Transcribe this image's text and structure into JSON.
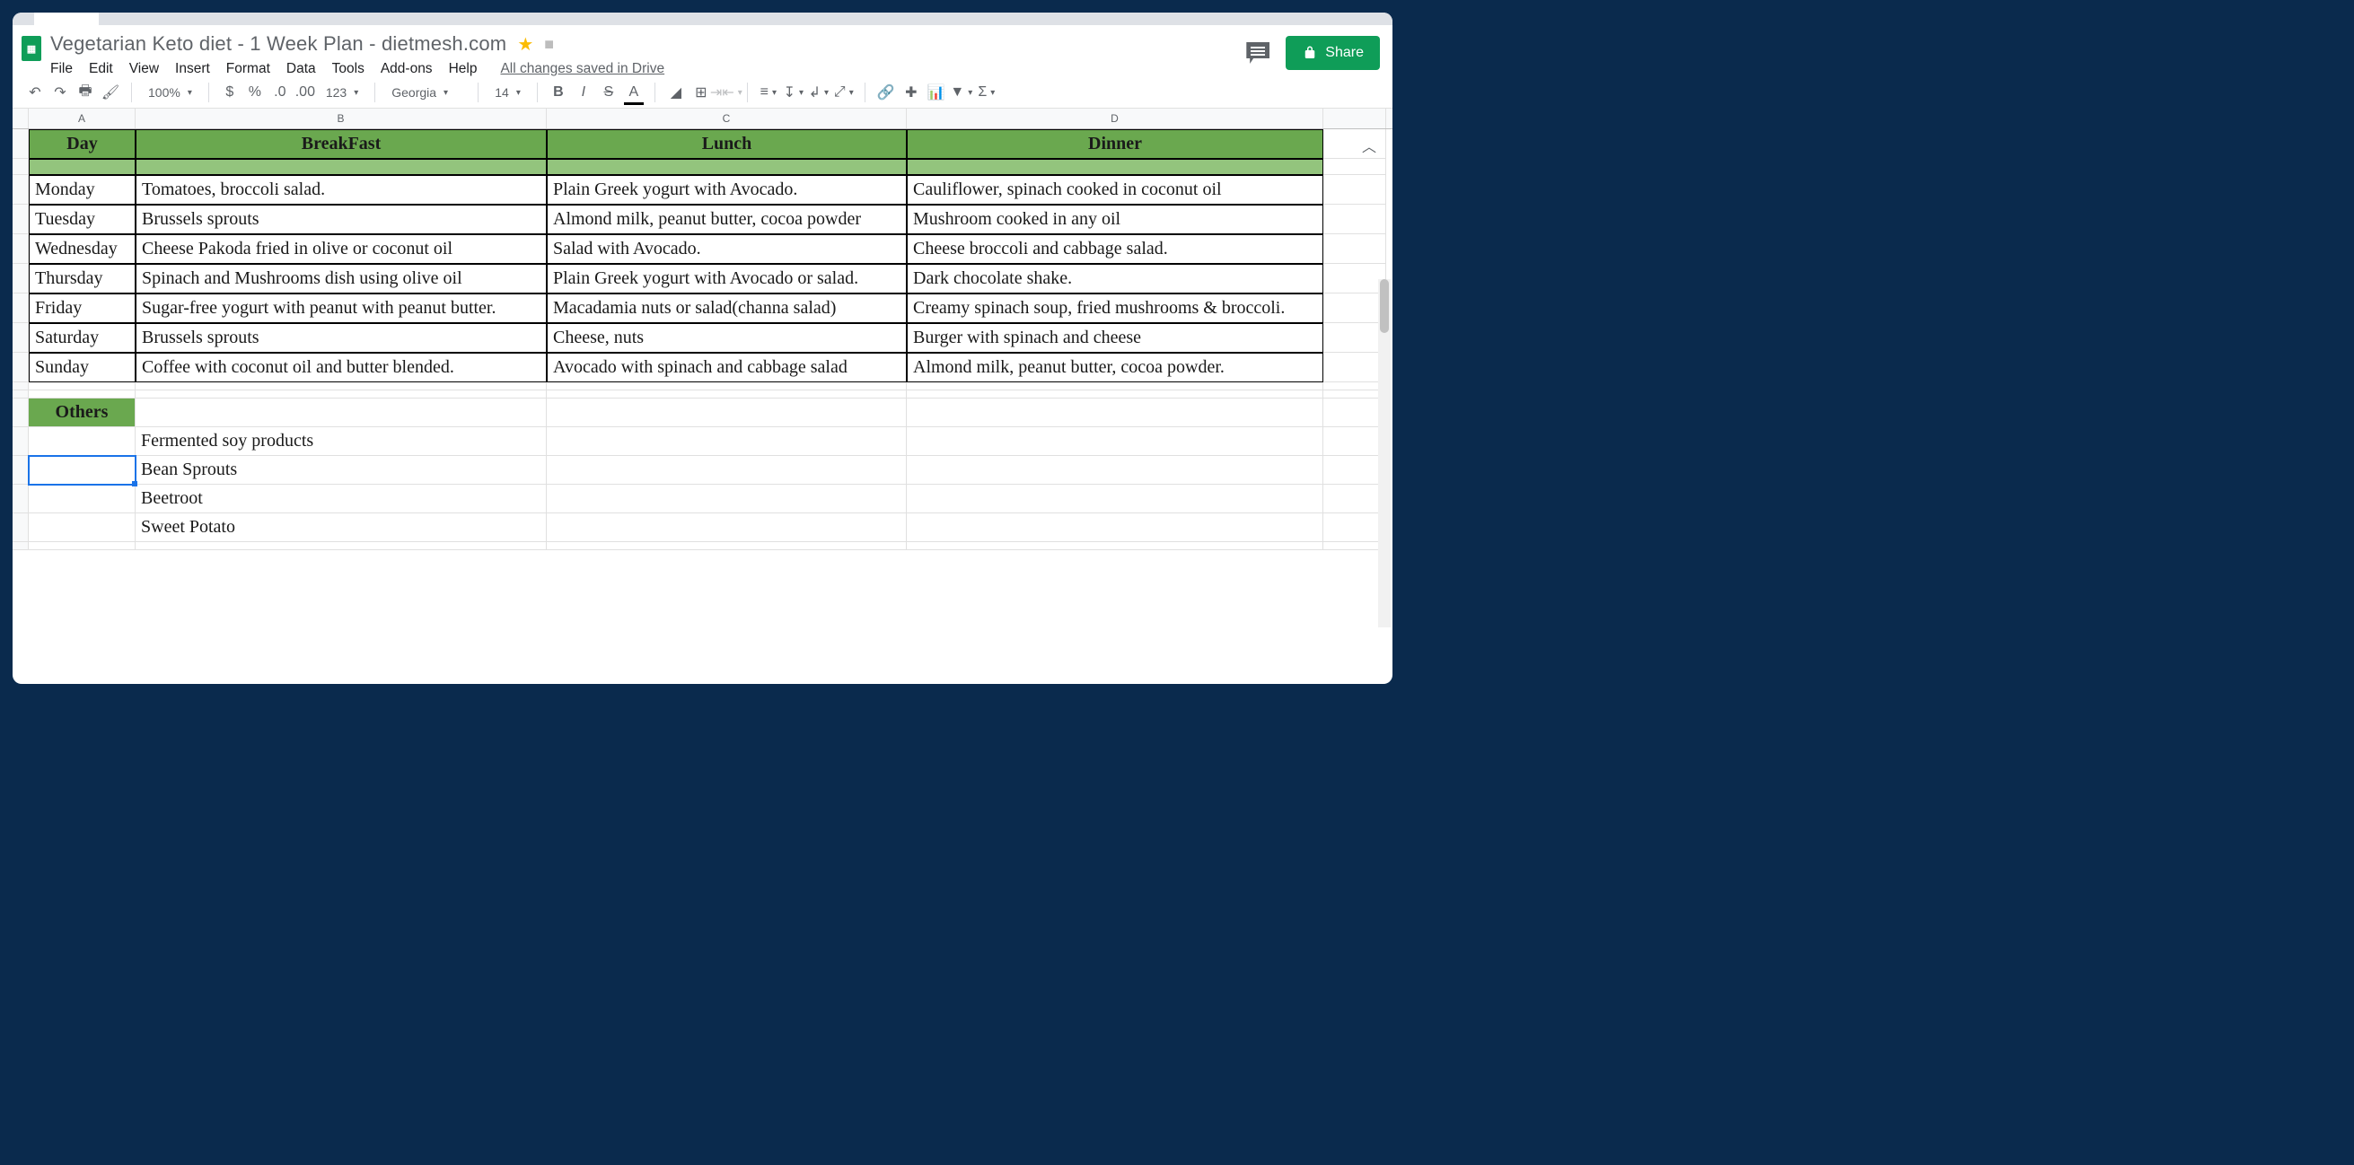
{
  "doc_title": "Vegetarian Keto diet - 1 Week Plan - dietmesh.com",
  "menus": [
    "File",
    "Edit",
    "View",
    "Insert",
    "Format",
    "Data",
    "Tools",
    "Add-ons",
    "Help"
  ],
  "saved_status": "All changes saved in Drive",
  "share_label": "Share",
  "toolbar": {
    "zoom": "100%",
    "font": "Georgia",
    "font_size": "14",
    "format_123": "123"
  },
  "columns": [
    "",
    "A",
    "B",
    "C",
    "D",
    ""
  ],
  "table_headers": {
    "day": "Day",
    "breakfast": "BreakFast",
    "lunch": "Lunch",
    "dinner": "Dinner"
  },
  "plan": [
    {
      "day": "Monday",
      "breakfast": "Tomatoes, broccoli salad.",
      "lunch": "Plain Greek yogurt with Avocado.",
      "dinner": "Cauliflower, spinach cooked in coconut oil"
    },
    {
      "day": "Tuesday",
      "breakfast": "Brussels sprouts",
      "lunch": "Almond milk, peanut butter, cocoa powder",
      "dinner": "Mushroom cooked in any oil"
    },
    {
      "day": "Wednesday",
      "breakfast": "Cheese Pakoda fried in olive or coconut oil",
      "lunch": "Salad with Avocado.",
      "dinner": "Cheese broccoli and cabbage salad."
    },
    {
      "day": "Thursday",
      "breakfast": "Spinach and Mushrooms dish using olive oil",
      "lunch": "Plain Greek yogurt with Avocado or salad.",
      "dinner": "Dark chocolate shake."
    },
    {
      "day": "Friday",
      "breakfast": "Sugar-free yogurt with peanut with peanut butter.",
      "lunch": "Macadamia nuts or salad(channa salad)",
      "dinner": "Creamy spinach soup, fried mushrooms & broccoli."
    },
    {
      "day": "Saturday",
      "breakfast": "Brussels sprouts",
      "lunch": "Cheese, nuts",
      "dinner": "Burger with spinach and cheese"
    },
    {
      "day": "Sunday",
      "breakfast": "Coffee with coconut oil and butter blended.",
      "lunch": "Avocado with spinach and cabbage salad",
      "dinner": "Almond milk, peanut butter, cocoa powder."
    }
  ],
  "others_header": "Others",
  "others": [
    "Fermented soy products",
    "Bean Sprouts",
    "Beetroot",
    "Sweet Potato"
  ]
}
